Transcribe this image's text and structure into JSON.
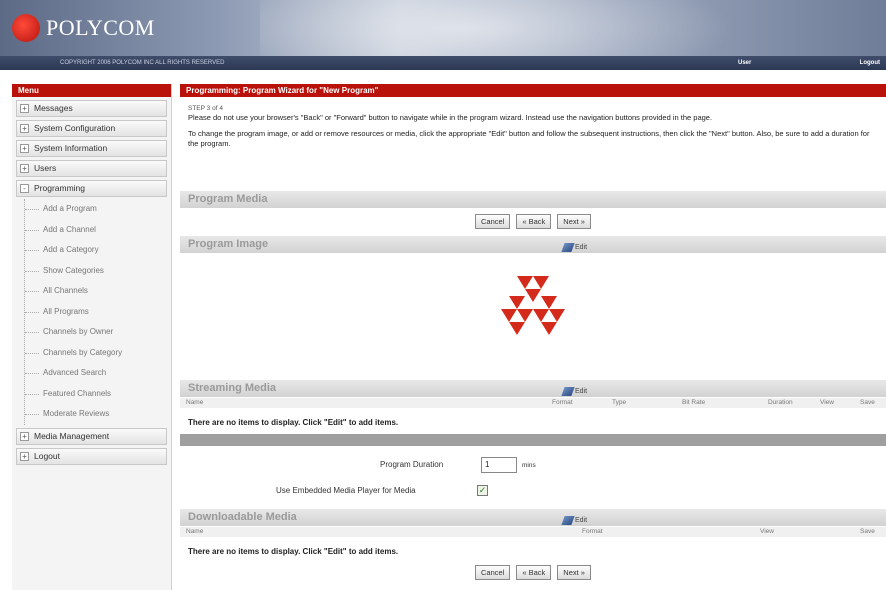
{
  "header": {
    "brand": "POLYCOM",
    "copyright": "COPYRIGHT 2006 POLYCOM INC ALL RIGHTS RESERVED",
    "user_label": "User",
    "logout_label": "Logout"
  },
  "sidebar": {
    "title": "Menu",
    "items": [
      {
        "label": "Messages",
        "toggle": "+"
      },
      {
        "label": "System Configuration",
        "toggle": "+"
      },
      {
        "label": "System Information",
        "toggle": "+"
      },
      {
        "label": "Users",
        "toggle": "+"
      },
      {
        "label": "Programming",
        "toggle": "-"
      }
    ],
    "programming_sub": [
      "Add a Program",
      "Add a Channel",
      "Add a Category",
      "Show Categories",
      "All Channels",
      "All Programs",
      "Channels by Owner",
      "Channels by Category",
      "Advanced Search",
      "Featured Channels",
      "Moderate Reviews"
    ],
    "bottom_items": [
      {
        "label": "Media Management",
        "toggle": "+"
      },
      {
        "label": "Logout",
        "toggle": "+"
      }
    ]
  },
  "main": {
    "title": "Programming: Program Wizard for \"New Program\"",
    "step": "STEP 3 of 4",
    "instruction_1": "Please do not use your browser's \"Back\" or \"Forward\" button to navigate while in the program wizard. Instead use the navigation buttons provided in the page.",
    "instruction_2": "To change the program image, or add or remove resources or media, click the appropriate \"Edit\" button and follow the subsequent instructions, then click the \"Next\" button. Also, be sure to add a duration for the program.",
    "program_media_heading": "Program Media",
    "buttons": {
      "cancel": "Cancel",
      "back": "« Back",
      "next": "Next »"
    },
    "program_image_heading": "Program Image",
    "edit_label": "Edit",
    "streaming_heading": "Streaming Media",
    "streaming_columns": [
      "Name",
      "Format",
      "Type",
      "Bit Rate",
      "Duration",
      "View",
      "Save"
    ],
    "empty_message": "There are no items to display. Click \"Edit\" to add items.",
    "duration_label": "Program Duration",
    "duration_value": "1",
    "duration_unit": "mins",
    "embedded_label": "Use Embedded Media Player for Media",
    "embedded_checked": "✓",
    "downloadable_heading": "Downloadable Media",
    "downloadable_columns": [
      "Name",
      "Format",
      "View",
      "Save"
    ]
  },
  "colors": {
    "brand_red": "#b8120a",
    "logo_red": "#d42a1c"
  }
}
